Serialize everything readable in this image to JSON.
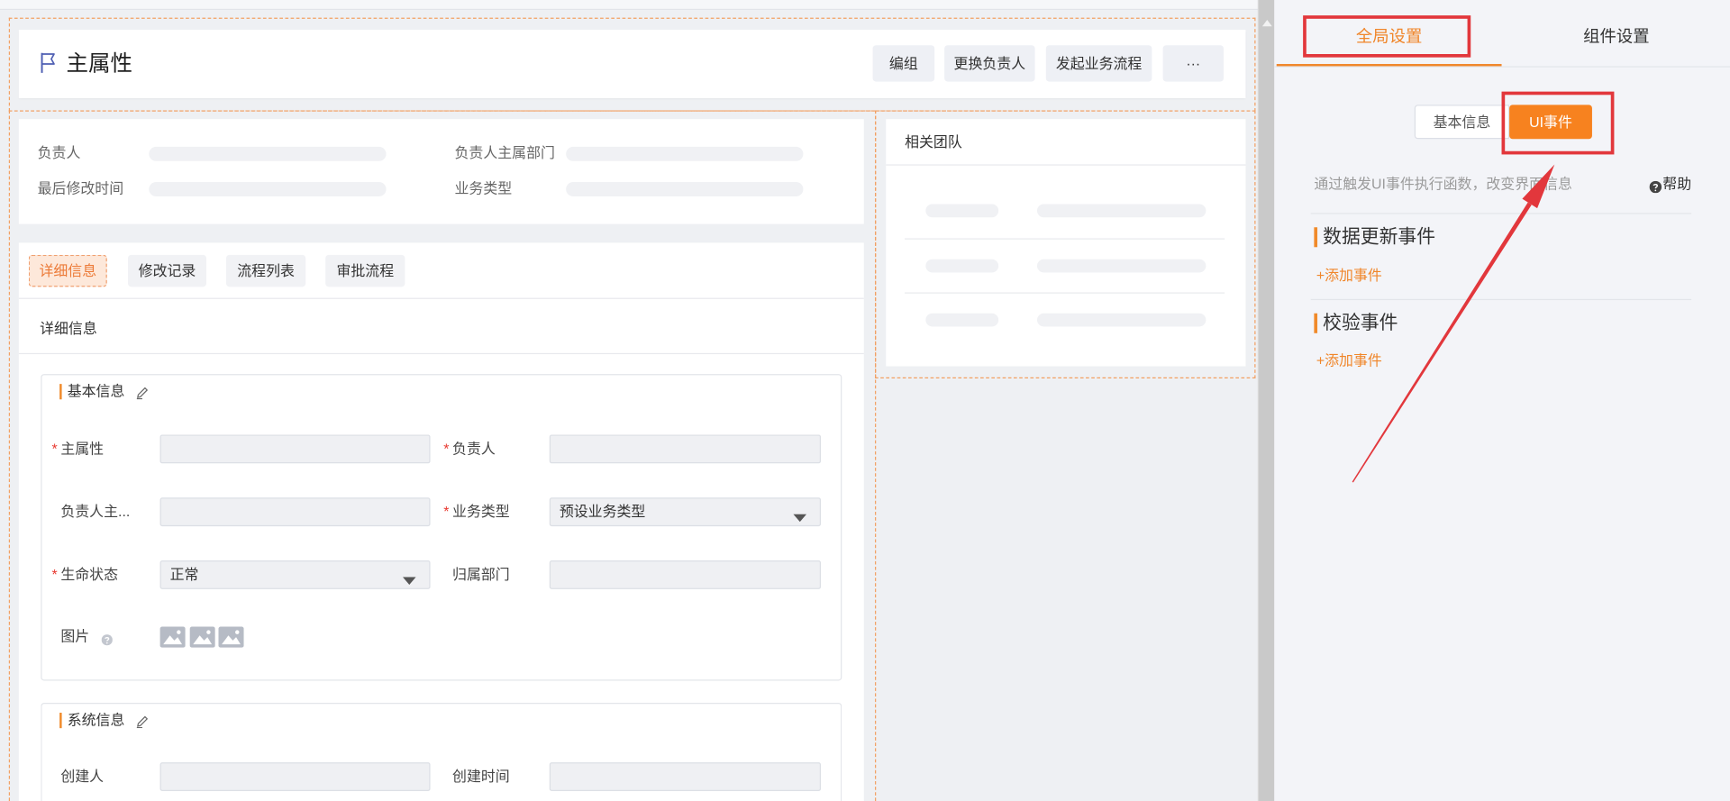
{
  "colors": {
    "accent": "#f0862a",
    "annotation_red": "#e2373c",
    "required": "#e8382f",
    "canvas_bg": "#eef0f3",
    "panel_bg": "#f3f4f8"
  },
  "header": {
    "title": "主属性",
    "icon": "flag-icon",
    "buttons": {
      "group": "编组",
      "change_owner": "更换负责人",
      "start_process": "发起业务流程",
      "more": "···"
    }
  },
  "summary": {
    "fields": [
      {
        "label": "负责人"
      },
      {
        "label": "负责人主属部门"
      },
      {
        "label": "最后修改时间"
      },
      {
        "label": "业务类型"
      }
    ]
  },
  "team": {
    "title": "相关团队"
  },
  "detail": {
    "tabs": [
      {
        "label": "详细信息",
        "active": true
      },
      {
        "label": "修改记录",
        "active": false
      },
      {
        "label": "流程列表",
        "active": false
      },
      {
        "label": "审批流程",
        "active": false
      }
    ],
    "panel_title": "详细信息",
    "required_mark": "*",
    "sections": [
      {
        "title": "基本信息",
        "fields": [
          {
            "label": "主属性",
            "required": true,
            "value": ""
          },
          {
            "label": "负责人",
            "required": true,
            "value": ""
          },
          {
            "label": "负责人主...",
            "required": false,
            "value": ""
          },
          {
            "label": "业务类型",
            "required": true,
            "value": "预设业务类型"
          },
          {
            "label": "生命状态",
            "required": true,
            "value": "正常"
          },
          {
            "label": "归属部门",
            "required": false,
            "value": ""
          },
          {
            "label": "图片",
            "required": false,
            "images": 3
          }
        ]
      },
      {
        "title": "系统信息",
        "fields": [
          {
            "label": "创建人",
            "value": ""
          },
          {
            "label": "创建时间",
            "value": ""
          }
        ]
      }
    ]
  },
  "right_panel": {
    "tabs": [
      {
        "label": "全局设置",
        "active": true
      },
      {
        "label": "组件设置",
        "active": false
      }
    ],
    "segments": [
      {
        "label": "基本信息",
        "active": false
      },
      {
        "label": "UI事件",
        "active": true
      }
    ],
    "description": "通过触发UI事件执行函数，改变界面信息",
    "help_label": "帮助",
    "event_groups": [
      {
        "title": "数据更新事件",
        "add_label": "+添加事件"
      },
      {
        "title": "校验事件",
        "add_label": "+添加事件"
      }
    ]
  }
}
